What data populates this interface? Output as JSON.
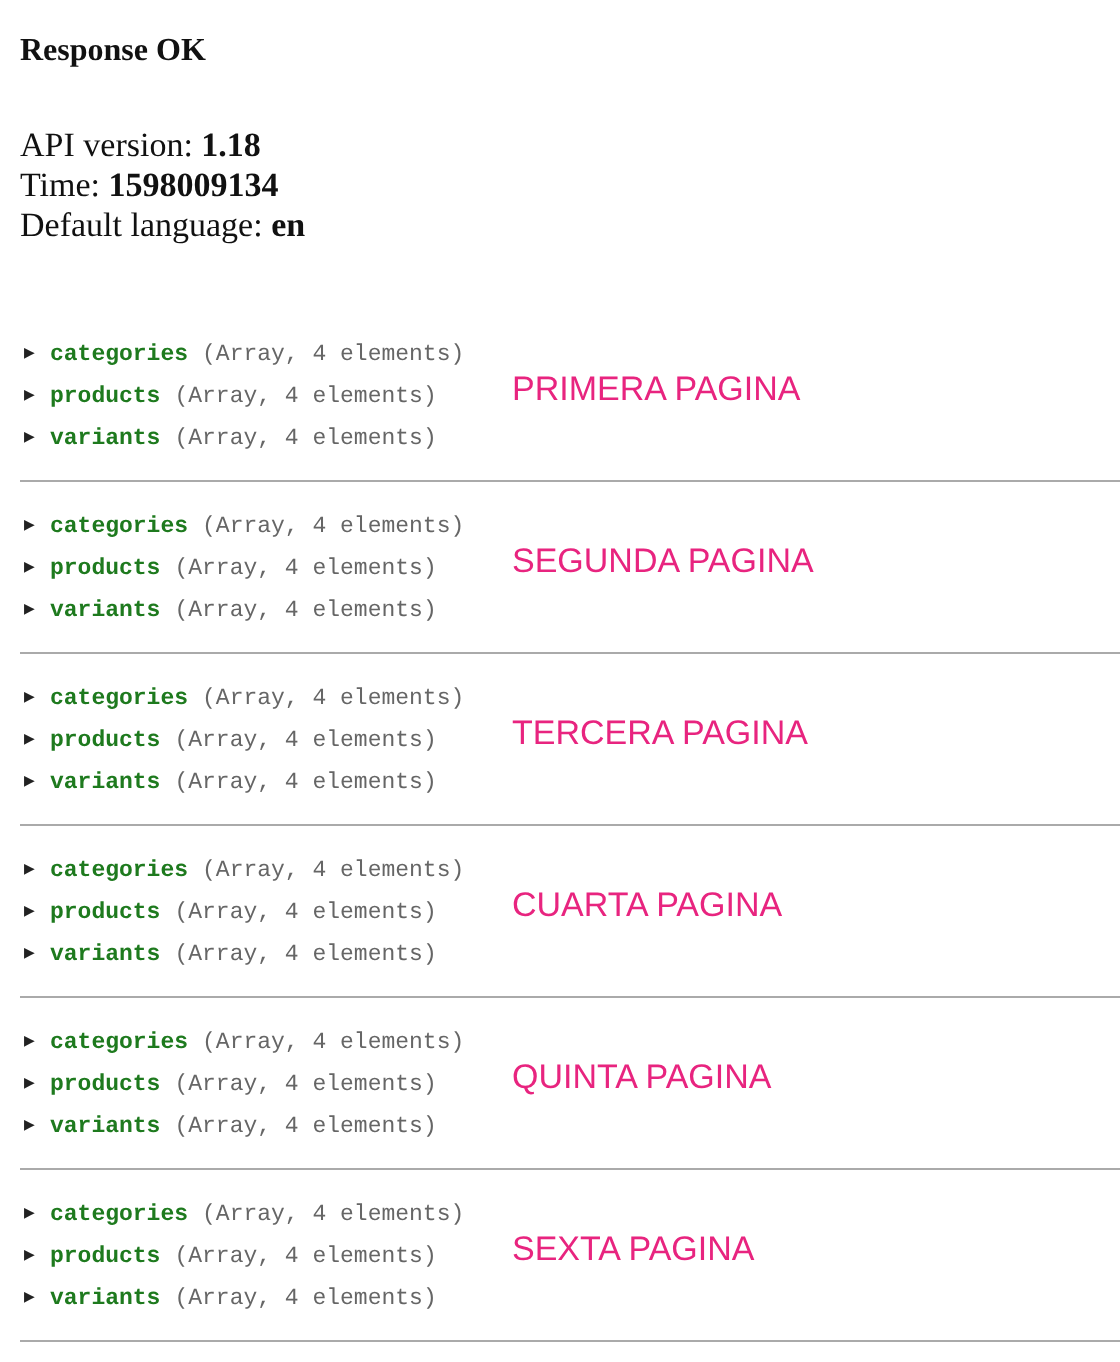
{
  "title": "Response OK",
  "info": [
    {
      "label": "API version:",
      "value": "1.18"
    },
    {
      "label": "Time:",
      "value": "1598009134"
    },
    {
      "label": "Default language:",
      "value": "en"
    }
  ],
  "sections": [
    {
      "note": "PRIMERA PAGINA",
      "rows": [
        {
          "arrow": "▶",
          "key": "categories",
          "summary": "(Array, 4 elements)"
        },
        {
          "arrow": "▶",
          "key": "products",
          "summary": "(Array, 4 elements)"
        },
        {
          "arrow": "▶",
          "key": "variants",
          "summary": "(Array, 4 elements)"
        }
      ]
    },
    {
      "note": "SEGUNDA PAGINA",
      "rows": [
        {
          "arrow": "▶",
          "key": "categories",
          "summary": "(Array, 4 elements)"
        },
        {
          "arrow": "▶",
          "key": "products",
          "summary": "(Array, 4 elements)"
        },
        {
          "arrow": "▶",
          "key": "variants",
          "summary": "(Array, 4 elements)"
        }
      ]
    },
    {
      "note": "TERCERA PAGINA",
      "rows": [
        {
          "arrow": "▶",
          "key": "categories",
          "summary": "(Array, 4 elements)"
        },
        {
          "arrow": "▶",
          "key": "products",
          "summary": "(Array, 4 elements)"
        },
        {
          "arrow": "▶",
          "key": "variants",
          "summary": "(Array, 4 elements)"
        }
      ]
    },
    {
      "note": "CUARTA PAGINA",
      "rows": [
        {
          "arrow": "▶",
          "key": "categories",
          "summary": "(Array, 4 elements)"
        },
        {
          "arrow": "▶",
          "key": "products",
          "summary": "(Array, 4 elements)"
        },
        {
          "arrow": "▶",
          "key": "variants",
          "summary": "(Array, 4 elements)"
        }
      ]
    },
    {
      "note": "QUINTA PAGINA",
      "rows": [
        {
          "arrow": "▶",
          "key": "categories",
          "summary": "(Array, 4 elements)"
        },
        {
          "arrow": "▶",
          "key": "products",
          "summary": "(Array, 4 elements)"
        },
        {
          "arrow": "▶",
          "key": "variants",
          "summary": "(Array, 4 elements)"
        }
      ]
    },
    {
      "note": "SEXTA PAGINA",
      "rows": [
        {
          "arrow": "▶",
          "key": "categories",
          "summary": "(Array, 4 elements)"
        },
        {
          "arrow": "▶",
          "key": "products",
          "summary": "(Array, 4 elements)"
        },
        {
          "arrow": "▶",
          "key": "variants",
          "summary": "(Array, 4 elements)"
        }
      ]
    }
  ]
}
